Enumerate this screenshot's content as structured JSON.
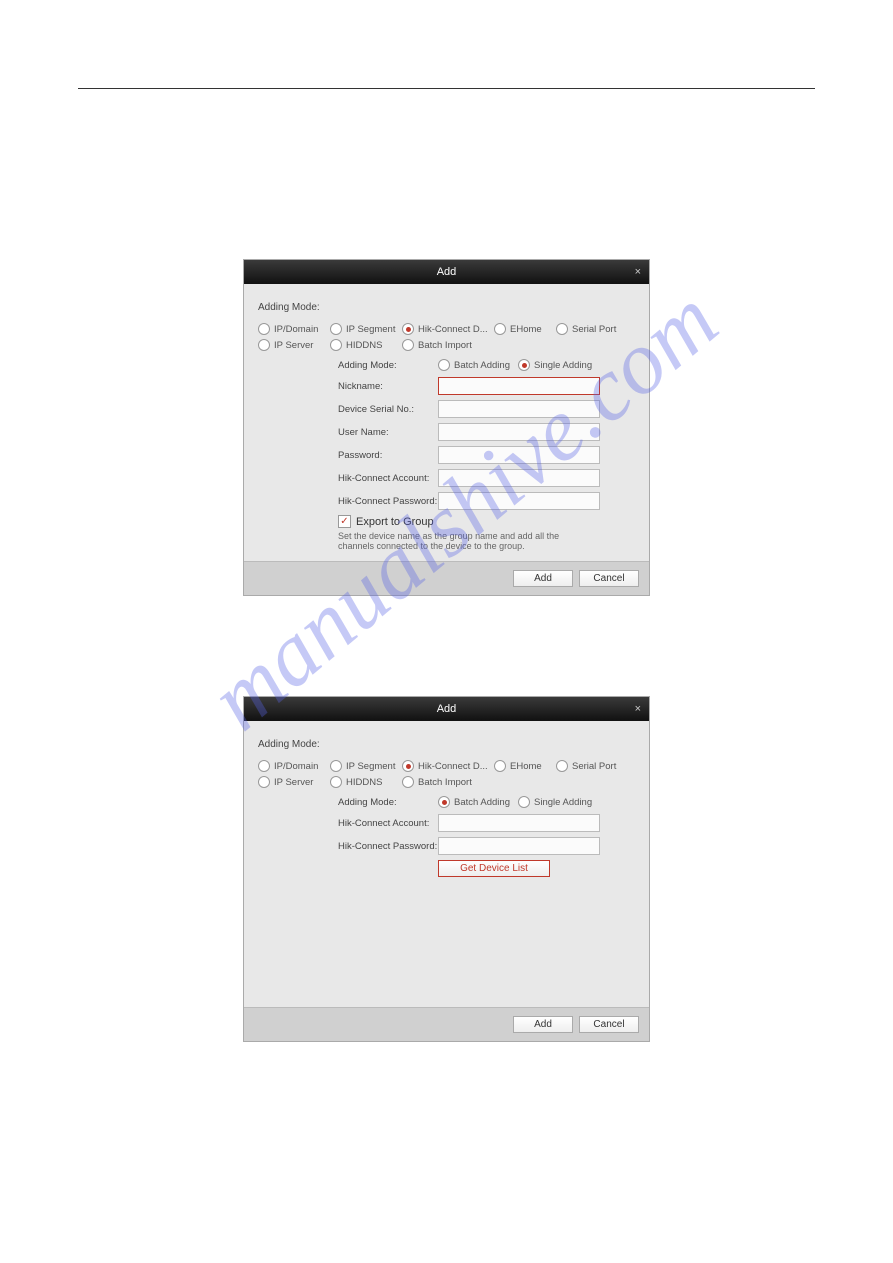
{
  "watermark": "manualshive.com",
  "dialog1": {
    "title": "Add",
    "mode_label": "Adding Mode:",
    "modes_row1": [
      "IP/Domain",
      "IP Segment",
      "Hik-Connect D...",
      "EHome",
      "Serial Port"
    ],
    "modes_row2": [
      "IP Server",
      "HIDDNS",
      "Batch Import"
    ],
    "selected_mode": "Hik-Connect D...",
    "sub_label": "Adding Mode:",
    "sub_modes": [
      "Batch Adding",
      "Single Adding"
    ],
    "selected_sub": "Single Adding",
    "fields": {
      "nickname": "Nickname:",
      "serial": "Device Serial No.:",
      "username": "User Name:",
      "password": "Password:",
      "account": "Hik-Connect Account:",
      "hc_password": "Hik-Connect Password:"
    },
    "export_label": "Export to Group",
    "help": "Set the device name as the group name and add all the channels connected to the device to the group.",
    "add_btn": "Add",
    "cancel_btn": "Cancel"
  },
  "dialog2": {
    "title": "Add",
    "mode_label": "Adding Mode:",
    "modes_row1": [
      "IP/Domain",
      "IP Segment",
      "Hik-Connect D...",
      "EHome",
      "Serial Port"
    ],
    "modes_row2": [
      "IP Server",
      "HIDDNS",
      "Batch Import"
    ],
    "selected_mode": "Hik-Connect D...",
    "sub_label": "Adding Mode:",
    "sub_modes": [
      "Batch Adding",
      "Single Adding"
    ],
    "selected_sub": "Batch Adding",
    "fields": {
      "account": "Hik-Connect Account:",
      "hc_password": "Hik-Connect Password:"
    },
    "get_list_btn": "Get Device List",
    "add_btn": "Add",
    "cancel_btn": "Cancel"
  }
}
